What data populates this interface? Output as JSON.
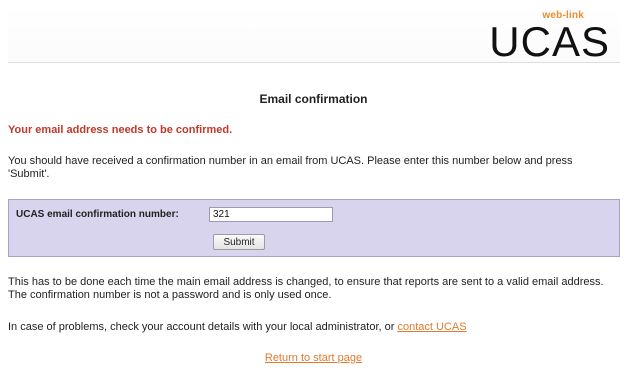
{
  "header": {
    "logo_top": "web-link",
    "logo_text": "UCAS"
  },
  "page": {
    "title": "Email confirmation",
    "warning": "Your email address needs to be confirmed.",
    "intro": "You should have received a confirmation number in an email from UCAS. Please enter this number below and press 'Submit'.",
    "form": {
      "label": "UCAS email confirmation number:",
      "value": "321",
      "submit_label": "Submit"
    },
    "info": "This has to be done each time the main email address is changed, to ensure that reports are sent to a valid email address. The confirmation number is not a password and is only used once.",
    "help_text": "In case of problems, check your account details with your local administrator, or ",
    "help_link": "contact UCAS",
    "return_link": "Return to start page"
  },
  "colors": {
    "brand_orange": "#f08a2b",
    "warning_red": "#c0392b",
    "form_bg": "#d8d4ee",
    "link": "#e07b2f"
  },
  "icons": [
    "ucas-logo-icon"
  ]
}
